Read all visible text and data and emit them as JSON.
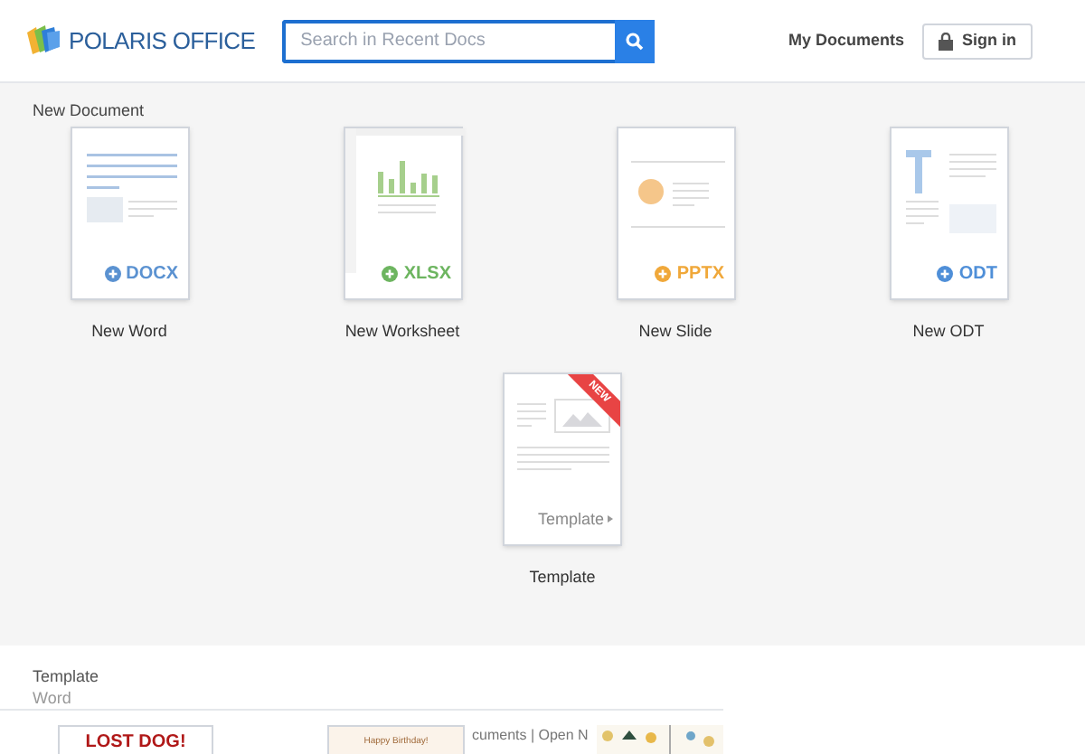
{
  "header": {
    "logo": "POLARIS OFFICE",
    "search": {
      "placeholder": "Search in Recent Docs"
    },
    "my_documents": "My Documents",
    "sign_in": "Sign in"
  },
  "new_document": {
    "title": "New Document",
    "items": [
      {
        "kind": "docx",
        "badge": "DOCX",
        "label": "New Word"
      },
      {
        "kind": "xlsx",
        "badge": "XLSX",
        "label": "New Worksheet"
      },
      {
        "kind": "pptx",
        "badge": "PPTX",
        "label": "New Slide"
      },
      {
        "kind": "odt",
        "badge": "ODT",
        "label": "New ODT"
      }
    ],
    "template": {
      "ribbon": "NEW",
      "badge": "Template",
      "label": "Template"
    }
  },
  "templates": {
    "title": "Template",
    "category": "Word",
    "overlay_text": "cuments | Open N",
    "thumbnails": [
      {
        "kind": "poster",
        "text": "LOST DOG!"
      },
      {
        "kind": "card",
        "text": "Happy Birthday!"
      }
    ]
  }
}
